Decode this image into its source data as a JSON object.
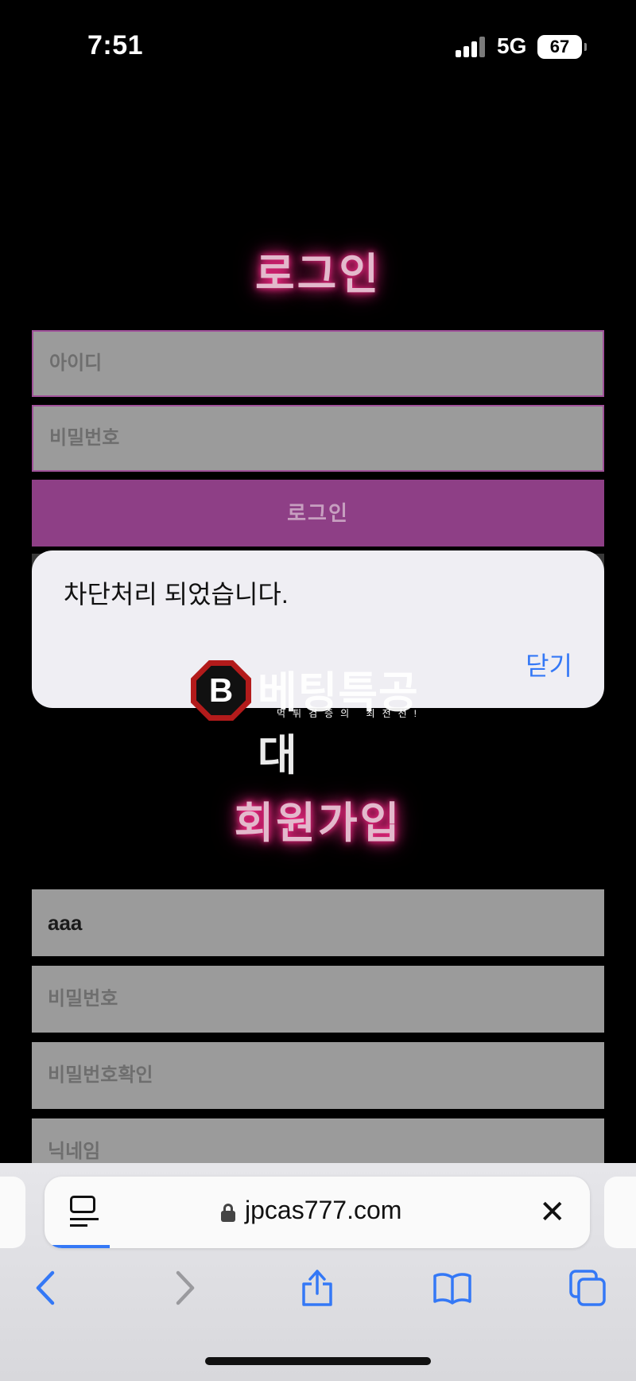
{
  "status_bar": {
    "time": "7:51",
    "network": "5G",
    "battery": "67"
  },
  "login": {
    "title": "로그인",
    "id_placeholder": "아이디",
    "password_placeholder": "비밀번호",
    "button_label": "로그인"
  },
  "alert": {
    "message": "차단처리 되었습니다.",
    "close_label": "닫기"
  },
  "watermark": {
    "badge_letter": "B",
    "title": "베팅특공대",
    "subtitle": "먹튀검증의 최전선!"
  },
  "signup": {
    "title": "회원가입",
    "id_value": "aaa",
    "password_placeholder": "비밀번호",
    "password_confirm_placeholder": "비밀번호확인",
    "nickname_placeholder": "닉네임"
  },
  "safari": {
    "url": "jpcas777.com",
    "close_label": "✕"
  },
  "colors": {
    "accent_blue": "#3478f6",
    "login_button": "#8e3f86",
    "title_glow": "#ff2a8a"
  }
}
